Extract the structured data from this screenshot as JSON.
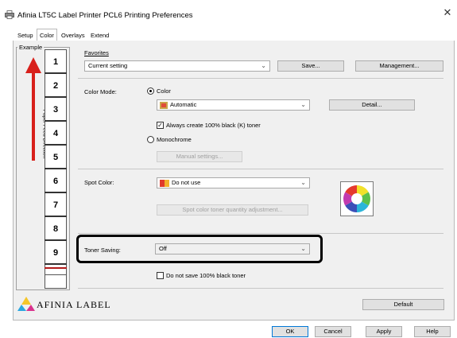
{
  "window": {
    "title": "Afinia LT5C Label Printer PCL6 Printing Preferences",
    "close_glyph": "✕"
  },
  "tabs": [
    {
      "label": "Setup",
      "active": false
    },
    {
      "label": "Color",
      "active": true
    },
    {
      "label": "Overlays",
      "active": false
    },
    {
      "label": "Extend",
      "active": false
    }
  ],
  "example": {
    "label": "Example",
    "direction_text": "Paper Feed Direction",
    "labels": [
      "1",
      "2",
      "3",
      "4",
      "5",
      "6",
      "7",
      "8",
      "9"
    ]
  },
  "favorites": {
    "label": "Favorites",
    "value": "Current setting",
    "save_button": "Save...",
    "management_button": "Management..."
  },
  "color_mode": {
    "label": "Color Mode:",
    "color_option": "Color",
    "color_selected": true,
    "color_profile": "Automatic",
    "detail_button": "Detail...",
    "always_black_label": "Always create 100% black (K) toner",
    "always_black_checked": true,
    "monochrome_option": "Monochrome",
    "manual_settings_button": "Manual settings..."
  },
  "spot_color": {
    "label": "Spot Color:",
    "value": "Do not use",
    "adjust_button": "Spot color toner quantity adjustment..."
  },
  "toner_saving": {
    "label": "Toner Saving:",
    "value": "Off",
    "no_save_black_label": "Do not save 100% black toner",
    "no_save_black_checked": false
  },
  "brand": {
    "logo_text": "AFINIA LABEL"
  },
  "default_button": "Default",
  "footer": {
    "ok": "OK",
    "cancel": "Cancel",
    "apply": "Apply",
    "help": "Help"
  },
  "colors": {
    "arrow": "#d8201b",
    "highlight_border": "#000000"
  }
}
